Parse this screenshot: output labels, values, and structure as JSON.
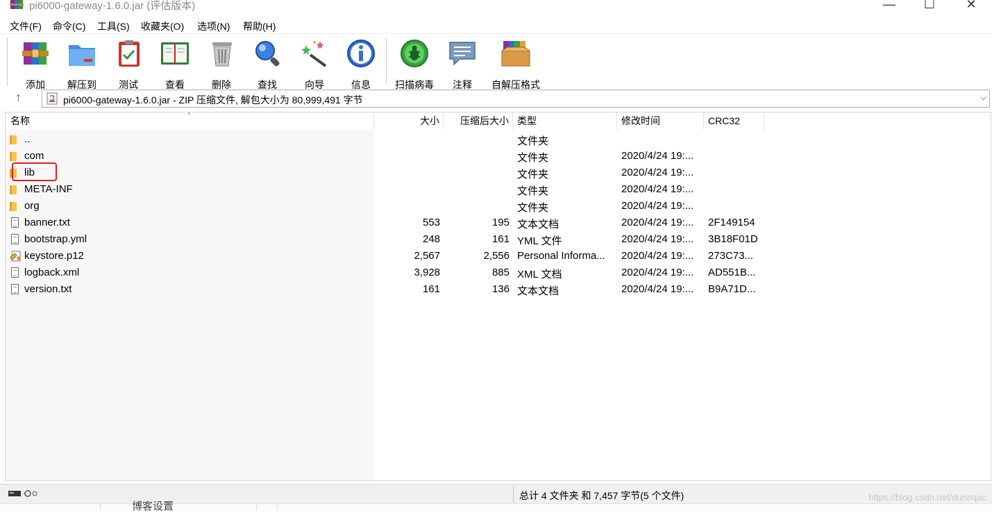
{
  "window": {
    "title": "pi6000-gateway-1.6.0.jar (评估版本)",
    "controls": {
      "minimize": "—",
      "maximize": "☐",
      "close": "✕"
    }
  },
  "menu": [
    "文件(F)",
    "命令(C)",
    "工具(S)",
    "收藏夹(O)",
    "选项(N)",
    "帮助(H)"
  ],
  "toolbar": [
    {
      "label": "添加",
      "icon": "add-archive-icon"
    },
    {
      "label": "解压到",
      "icon": "extract-to-icon"
    },
    {
      "label": "测试",
      "icon": "test-icon"
    },
    {
      "label": "查看",
      "icon": "view-book-icon"
    },
    {
      "label": "删除",
      "icon": "trash-icon"
    },
    {
      "label": "查找",
      "icon": "find-icon"
    },
    {
      "label": "向导",
      "icon": "wizard-wand-icon"
    },
    {
      "label": "信息",
      "icon": "info-icon"
    },
    {
      "label": "扫描病毒",
      "icon": "virus-scan-icon"
    },
    {
      "label": "注释",
      "icon": "comment-icon"
    },
    {
      "label": "自解压格式",
      "icon": "sfx-box-icon"
    }
  ],
  "address": {
    "path": "pi6000-gateway-1.6.0.jar - ZIP 压缩文件, 解包大小为 80,999,491 字节",
    "up": "↑",
    "dropdown": "⌵"
  },
  "columns": {
    "name": "名称",
    "size": "大小",
    "packed": "压缩后大小",
    "type": "类型",
    "modified": "修改时间",
    "crc": "CRC32",
    "sort_indicator": "^"
  },
  "files": [
    {
      "name": "..",
      "size": "",
      "packed": "",
      "type": "文件夹",
      "modified": "",
      "crc": "",
      "kind": "folder"
    },
    {
      "name": "com",
      "size": "",
      "packed": "",
      "type": "文件夹",
      "modified": "2020/4/24 19:...",
      "crc": "",
      "kind": "folder"
    },
    {
      "name": "lib",
      "size": "",
      "packed": "",
      "type": "文件夹",
      "modified": "2020/4/24 19:...",
      "crc": "",
      "kind": "folder"
    },
    {
      "name": "META-INF",
      "size": "",
      "packed": "",
      "type": "文件夹",
      "modified": "2020/4/24 19:...",
      "crc": "",
      "kind": "folder"
    },
    {
      "name": "org",
      "size": "",
      "packed": "",
      "type": "文件夹",
      "modified": "2020/4/24 19:...",
      "crc": "",
      "kind": "folder"
    },
    {
      "name": "banner.txt",
      "size": "553",
      "packed": "195",
      "type": "文本文档",
      "modified": "2020/4/24 19:...",
      "crc": "2F149154",
      "kind": "doc"
    },
    {
      "name": "bootstrap.yml",
      "size": "248",
      "packed": "161",
      "type": "YML 文件",
      "modified": "2020/4/24 19:...",
      "crc": "3B18F01D",
      "kind": "doc"
    },
    {
      "name": "keystore.p12",
      "size": "2,567",
      "packed": "2,556",
      "type": "Personal Informa...",
      "modified": "2020/4/24 19:...",
      "crc": "273C73...",
      "kind": "cert"
    },
    {
      "name": "logback.xml",
      "size": "3,928",
      "packed": "885",
      "type": "XML 文档",
      "modified": "2020/4/24 19:...",
      "crc": "AD551B...",
      "kind": "doc"
    },
    {
      "name": "version.txt",
      "size": "161",
      "packed": "136",
      "type": "文本文档",
      "modified": "2020/4/24 19:...",
      "crc": "B9A71D...",
      "kind": "doc"
    }
  ],
  "status": {
    "summary": "总计 4 文件夹 和 7,457 字节(5 个文件)"
  },
  "background": {
    "partial_text": "博客设置"
  },
  "watermark": "https://blog.csdn.net/duneqac",
  "colors": {
    "highlight": "#e51d1d",
    "folder": "#f3c54c"
  }
}
